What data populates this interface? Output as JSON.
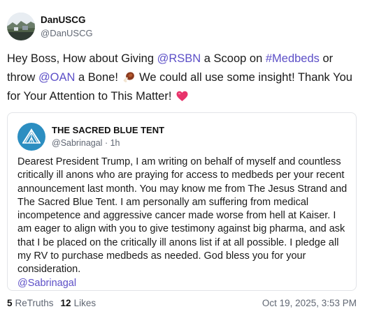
{
  "post": {
    "author": {
      "display_name": "DanUSCG",
      "handle": "@DanUSCG",
      "avatar_icon": "landscape-avatar"
    },
    "text": {
      "p1": "Hey Boss, How about Giving ",
      "m1": "@RSBN",
      "p2": " a Scoop on ",
      "h1": "#Medbeds",
      "p3": " or throw ",
      "m2": "@OAN",
      "p4": " a Bone! ",
      "p5": " We could all use some insight! Thank You for Your Attention to This Matter! ",
      "emoji1": "turkey-leg-emoji",
      "emoji2": "heart-emoji"
    },
    "quote": {
      "author": {
        "display_name": "THE SACRED BLUE TENT",
        "handle": "@Sabrinagal",
        "time": "1h",
        "separator": "·",
        "avatar_icon": "blue-tent-logo"
      },
      "text": "Dearest President Trump, I am writing on behalf of myself and countless critically ill anons who are praying for access to medbeds per your recent announcement last month.  You may know me from The Jesus Strand and The Sacred Blue Tent. I am personally am suffering from medical incompetence and aggressive cancer made worse from  hell at Kaiser. I am eager to align with you to give testimony against big pharma, and ask that I be placed on the critically ill anons list if at all possible. I pledge all my RV to purchase medbeds as needed. God bless you for your consideration.",
      "mention": "@Sabrinagal"
    },
    "stats": {
      "retruths_count": "5",
      "retruths_label": "ReTruths",
      "likes_count": "12",
      "likes_label": "Likes",
      "timestamp": "Oct 19, 2025, 3:53 PM"
    },
    "colors": {
      "link": "#5c4fc7",
      "tent_blue": "#2c8ec1",
      "muted": "#606773",
      "border": "#e2e4e8"
    }
  }
}
